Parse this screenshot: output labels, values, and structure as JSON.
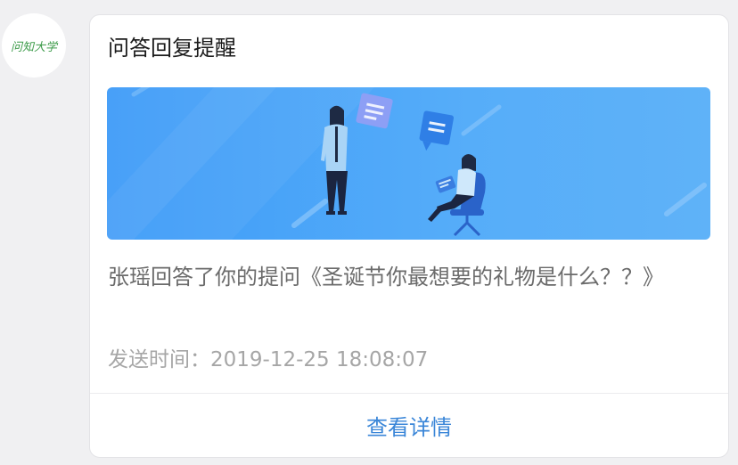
{
  "account": {
    "avatar_text": "问知大学"
  },
  "card": {
    "title": "问答回复提醒",
    "banner_icon": "qa-illustration",
    "message": "张瑶回答了你的提问《圣诞节你最想要的礼物是什么？？》",
    "time_label": "发送时间：",
    "time_value": "2019-12-25 18:08:07",
    "detail_button": "查看详情"
  },
  "colors": {
    "banner": "#3d9bf8",
    "link": "#3a86d8",
    "avatar_text": "#3d9b4a"
  }
}
